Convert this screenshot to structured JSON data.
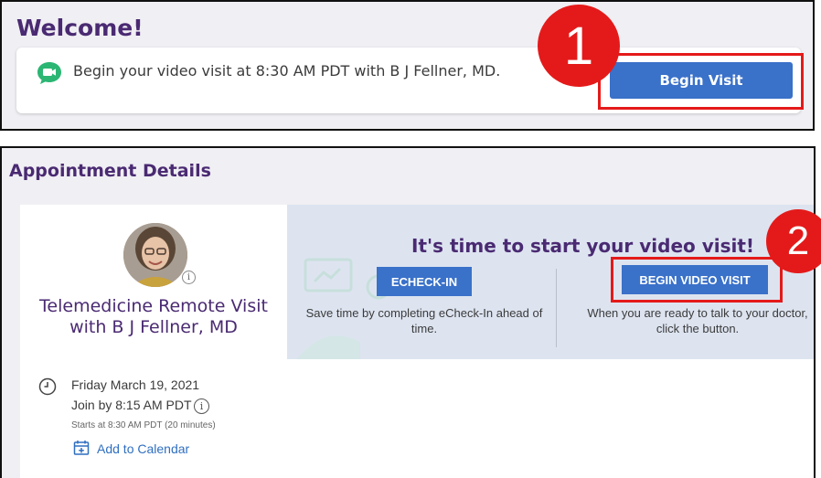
{
  "welcome": {
    "title": "Welcome!",
    "message": "Begin your video visit at 8:30 AM PDT with B J Fellner, MD.",
    "begin_visit_label": "Begin Visit",
    "step_badge": "1"
  },
  "appointment": {
    "section_title": "Appointment Details",
    "visit_title": "Telemedicine Remote Visit with B J Fellner, MD",
    "date": "Friday March 19, 2021",
    "join_by": "Join by 8:15 AM PDT",
    "starts": "Starts at 8:30 AM PDT (20 minutes)",
    "add_to_calendar": "Add to Calendar",
    "info_glyph": "i"
  },
  "actions": {
    "heading": "It's time to start your video visit!",
    "echeck_label": "ECHECK-IN",
    "echeck_desc": "Save time by completing eCheck-In ahead of time.",
    "begin_video_label": "BEGIN VIDEO VISIT",
    "begin_video_desc": "When you are ready to talk to your doctor, click the button.",
    "step_badge": "2"
  },
  "colors": {
    "accent_purple": "#4a2a72",
    "button_blue": "#3a71c9",
    "highlight_red": "#e41a1a",
    "video_icon_green": "#2bb673",
    "link_blue": "#2f6fc0"
  },
  "icons": {
    "video": "video-chat-icon",
    "clock": "clock-icon",
    "calendar": "calendar-add-icon",
    "info": "info-icon"
  }
}
